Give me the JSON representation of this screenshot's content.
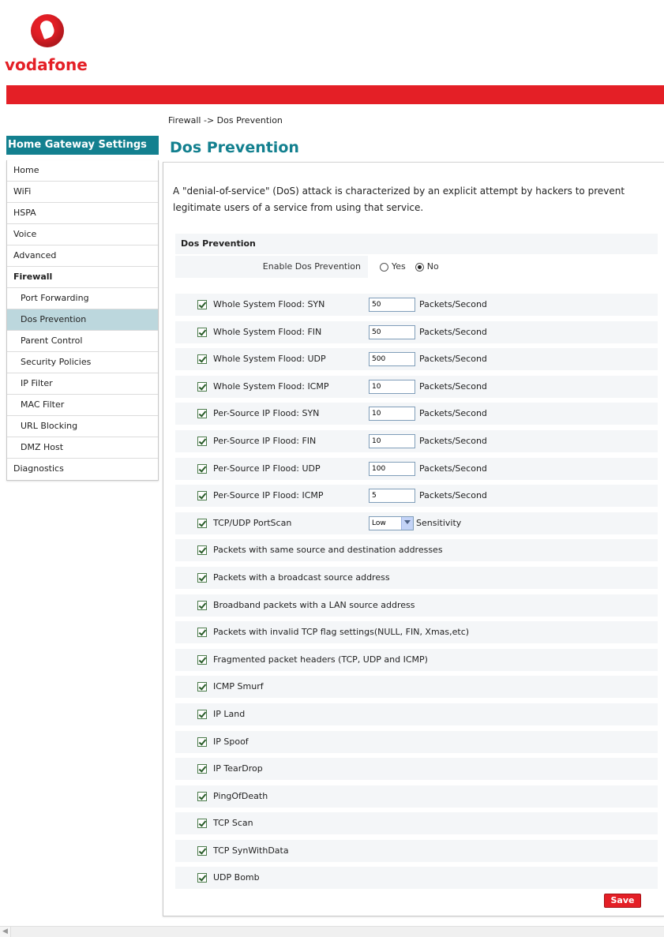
{
  "brand": {
    "name": "vodafone",
    "color": "#e41f26",
    "accent": "#13808f"
  },
  "breadcrumb": "Firewall -> Dos Prevention",
  "sidebar": {
    "title": "Home Gateway Settings",
    "items": [
      {
        "label": "Home"
      },
      {
        "label": "WiFi"
      },
      {
        "label": "HSPA"
      },
      {
        "label": "Voice"
      },
      {
        "label": "Advanced"
      },
      {
        "label": "Firewall"
      },
      {
        "label": "Port Forwarding"
      },
      {
        "label": "Dos Prevention"
      },
      {
        "label": "Parent Control"
      },
      {
        "label": "Security Policies"
      },
      {
        "label": "IP Filter"
      },
      {
        "label": "MAC Filter"
      },
      {
        "label": "URL Blocking"
      },
      {
        "label": "DMZ Host"
      },
      {
        "label": "Diagnostics"
      }
    ]
  },
  "main": {
    "title": "Dos Prevention",
    "intro": "A \"denial-of-service\" (DoS) attack is characterized by an explicit attempt by hackers to prevent legitimate users of a service from using that service.",
    "section_title": "Dos Prevention",
    "enable": {
      "label": "Enable Dos Prevention",
      "yes": "Yes",
      "no": "No",
      "selected": "No"
    },
    "unit": "Packets/Second",
    "sensitivity_label": "Sensitivity",
    "rows": [
      {
        "label": "Whole System Flood: SYN",
        "value": "50",
        "checked": true
      },
      {
        "label": "Whole System Flood: FIN",
        "value": "50",
        "checked": true
      },
      {
        "label": "Whole System Flood: UDP",
        "value": "500",
        "checked": true
      },
      {
        "label": "Whole System Flood: ICMP",
        "value": "10",
        "checked": true
      },
      {
        "label": "Per-Source IP Flood: SYN",
        "value": "10",
        "checked": true
      },
      {
        "label": "Per-Source IP Flood: FIN",
        "value": "10",
        "checked": true
      },
      {
        "label": "Per-Source IP Flood: UDP",
        "value": "100",
        "checked": true
      },
      {
        "label": "Per-Source IP Flood: ICMP",
        "value": "5",
        "checked": true
      },
      {
        "label": "TCP/UDP PortScan",
        "select": "Low",
        "checked": true
      },
      {
        "label": "Packets with same source and destination addresses",
        "checked": true
      },
      {
        "label": "Packets with a broadcast source address",
        "checked": true
      },
      {
        "label": "Broadband packets with a LAN source address",
        "checked": true
      },
      {
        "label": "Packets with invalid TCP flag settings(NULL, FIN, Xmas,etc)",
        "checked": true
      },
      {
        "label": "Fragmented packet headers (TCP, UDP and ICMP)",
        "checked": true
      },
      {
        "label": "ICMP Smurf",
        "checked": true
      },
      {
        "label": "IP Land",
        "checked": true
      },
      {
        "label": "IP Spoof",
        "checked": true
      },
      {
        "label": "IP TearDrop",
        "checked": true
      },
      {
        "label": "PingOfDeath",
        "checked": true
      },
      {
        "label": "TCP Scan",
        "checked": true
      },
      {
        "label": "TCP SynWithData",
        "checked": true
      },
      {
        "label": "UDP Bomb",
        "checked": true
      }
    ],
    "save_label": "Save"
  },
  "icons": {
    "scroll_left": "chevron-left-icon"
  }
}
